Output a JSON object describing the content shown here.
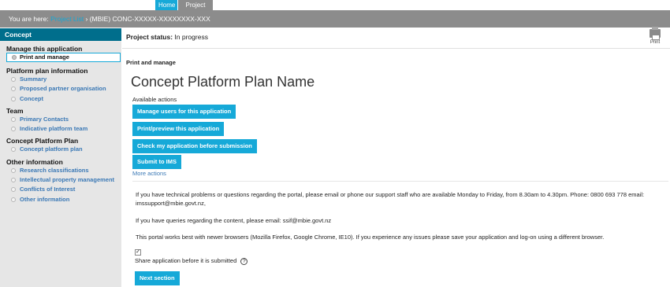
{
  "topnav": {
    "home": "Home",
    "project_list": "Project List"
  },
  "breadcrumb": {
    "prefix": "You are here:",
    "link": "Project List",
    "current": "› (MBIE) CONC-XXXXX-XXXXXXXX-XXX"
  },
  "sidebar": {
    "heading": "Concept",
    "sections": [
      {
        "title": "Manage this application",
        "items": [
          "Print and manage"
        ]
      },
      {
        "title": "Platform plan information",
        "items": [
          "Summary",
          "Proposed partner organisation",
          "Concept"
        ]
      },
      {
        "title": "Team",
        "items": [
          "Primary Contacts",
          "Indicative platform team"
        ]
      },
      {
        "title": "Concept Platform Plan",
        "items": [
          "Concept platform plan"
        ]
      },
      {
        "title": "Other information",
        "items": [
          "Research classifications",
          "Intellectual property management",
          "Conflicts of Interest",
          "Other information"
        ]
      }
    ]
  },
  "status": {
    "label": "Project status:",
    "value": "In progress"
  },
  "print": {
    "label": "Print",
    "icon": "printer-icon"
  },
  "main": {
    "subtitle": "Print and manage",
    "title": "Concept Platform Plan Name",
    "actions_label": "Available actions",
    "buttons": [
      "Manage users for this application",
      "Print/preview this application",
      "Check my application before submission",
      "Submit to IMS"
    ],
    "more_actions": "More actions",
    "info": [
      "If you have technical problems or questions regarding the portal, please email or phone our support staff who are available Monday to Friday, from 8.30am to 4.30pm. Phone: 0800 693 778 email: imssupport@mbie.govt.nz,",
      "If you have queries regarding the content, please email: ssif@mbie.govt.nz",
      "This portal works best with newer browsers (Mozilla Firefox, Google Chrome, IE10). If you experience any issues please save your application and log-on using a different browser."
    ],
    "share_label": "Share application before it is submitted",
    "share_checked": "✓",
    "help_icon": "?",
    "next_button": "Next section"
  },
  "colors": {
    "accent": "#16a9d8",
    "sidebar_head": "#006e8c",
    "bar": "#8c8c8c"
  }
}
